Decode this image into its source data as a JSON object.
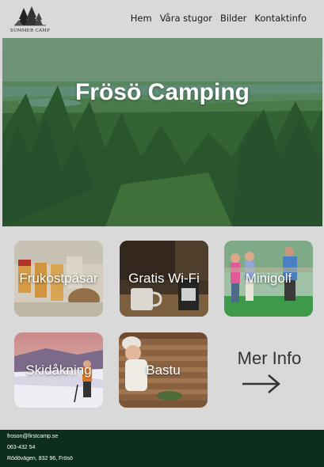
{
  "header": {
    "logo_text": "SUMMER CAMP",
    "nav": [
      "Hem",
      "Våra stugor",
      "Bilder",
      "Kontaktinfo"
    ]
  },
  "hero": {
    "title": "Frösö Camping"
  },
  "tiles": [
    {
      "label": "Frukostpåsar"
    },
    {
      "label": "Gratis Wi-Fi"
    },
    {
      "label": "Minigolf"
    },
    {
      "label": "Skidåkning"
    },
    {
      "label": "Bastu"
    }
  ],
  "more": {
    "label": "Mer Info",
    "icon": "arrow-right-icon"
  },
  "footer": {
    "email": "froson@firstcamp.se",
    "phone": "063-432 54",
    "address": "Rödövägen, 832 96, Frösö"
  },
  "colors": {
    "background": "#d9d9d9",
    "footer": "#0b2e1d",
    "hero_overlay": "#3f7a4e"
  }
}
